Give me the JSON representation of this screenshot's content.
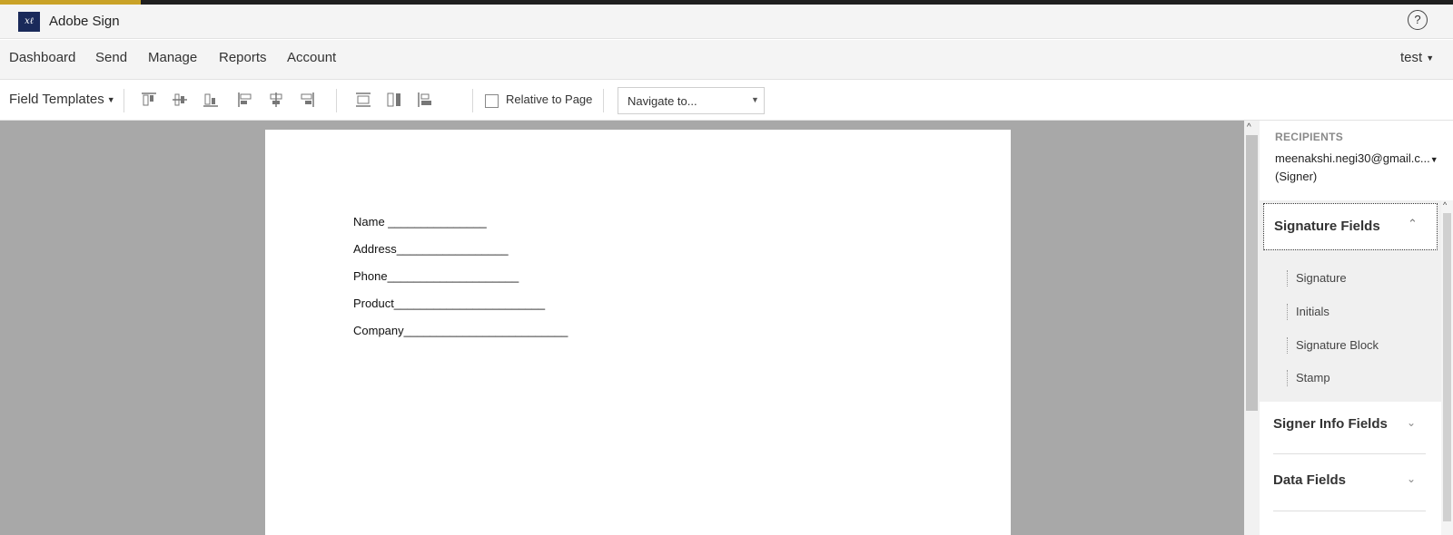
{
  "app": {
    "title": "Adobe Sign",
    "logo_icon": "adobe-sign-logo-icon",
    "help_glyph": "?"
  },
  "colors": {
    "accent": "#c9a227",
    "top_bar": "#1f1f1f",
    "logo_bg": "#1a2a5a",
    "viewer_bg": "#a8a8a8"
  },
  "nav": {
    "items": [
      {
        "label": "Dashboard"
      },
      {
        "label": "Send"
      },
      {
        "label": "Manage"
      },
      {
        "label": "Reports"
      },
      {
        "label": "Account"
      }
    ],
    "user": "test"
  },
  "toolbar": {
    "field_templates_label": "Field Templates",
    "align_icons": [
      "align-top-icon",
      "align-middle-icon",
      "align-bottom-icon",
      "align-left-icon",
      "align-center-icon",
      "align-right-icon",
      "distribute-vertical-icon",
      "match-height-icon",
      "distribute-horizontal-icon"
    ],
    "relative_to_page_label": "Relative to Page",
    "relative_to_page_checked": false,
    "navigate_value": "Navigate to..."
  },
  "document": {
    "lines": [
      {
        "text": "Name _______________"
      },
      {
        "text": "Address_________________"
      },
      {
        "text": "Phone____________________"
      },
      {
        "text": "Product_______________________"
      },
      {
        "text": "Company_________________________"
      }
    ]
  },
  "panel": {
    "recipients_label": "RECIPIENTS",
    "recipient_email": "meenakshi.negi30@gmail.c...",
    "recipient_role": "(Signer)",
    "signature_fields_title": "Signature Fields",
    "signature_fields": [
      {
        "label": "Signature"
      },
      {
        "label": "Initials"
      },
      {
        "label": "Signature Block"
      },
      {
        "label": "Stamp"
      }
    ],
    "signer_info_title": "Signer Info Fields",
    "data_fields_title": "Data Fields"
  }
}
